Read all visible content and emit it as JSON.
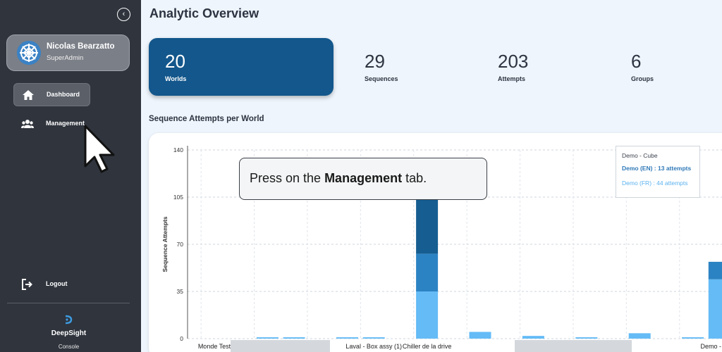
{
  "sidebar": {
    "collapse_icon": "chevron-left-icon",
    "user": {
      "name": "Nicolas Bearzatto",
      "role": "SuperAdmin",
      "avatar_icon": "snowflake-avatar-icon"
    },
    "items": [
      {
        "label": "Dashboard",
        "icon": "home-icon",
        "active": true
      },
      {
        "label": "Management",
        "icon": "users-icon",
        "active": false
      }
    ],
    "logout_label": "Logout",
    "brand": {
      "name": "DeepSight",
      "sub": "Console"
    }
  },
  "header": {
    "title": "Analytic Overview"
  },
  "stats": [
    {
      "value": "20",
      "label": "Worlds",
      "highlight": true
    },
    {
      "value": "29",
      "label": "Sequences"
    },
    {
      "value": "203",
      "label": "Attempts"
    },
    {
      "value": "6",
      "label": "Groups"
    }
  ],
  "section_title": "Sequence Attempts per World",
  "chart_data": {
    "type": "bar",
    "stacked": true,
    "ylabel": "Sequence Attempts",
    "ylim": [
      0,
      140
    ],
    "yticks": [
      "0",
      "35",
      "70",
      "105",
      "140"
    ],
    "categories": [
      "Monde Test",
      "",
      "",
      "",
      "",
      "",
      "Laval - Box assy (1)",
      "",
      "Chiller de la drive",
      "",
      "",
      "",
      "",
      "",
      "",
      "",
      "",
      "",
      "",
      "Demo - Cube"
    ],
    "series": [
      {
        "name": "",
        "color": "#64bbf6",
        "values": [
          0,
          0,
          1,
          1,
          0,
          1,
          1,
          0,
          35,
          0,
          5,
          0,
          2,
          0,
          1,
          0,
          4,
          0,
          1,
          44
        ]
      },
      {
        "name": "",
        "color": "#2c83c3",
        "values": [
          0,
          0,
          0,
          0,
          0,
          0,
          0,
          0,
          28,
          0,
          0,
          0,
          0,
          0,
          0,
          0,
          0,
          0,
          0,
          13
        ]
      },
      {
        "name": "",
        "color": "#165e91",
        "values": [
          0,
          0,
          0,
          0,
          0,
          0,
          0,
          0,
          40,
          0,
          0,
          0,
          0,
          0,
          0,
          0,
          0,
          0,
          0,
          0
        ]
      }
    ],
    "legend": {
      "title": "Demo - Cube",
      "entries": [
        "Demo (EN) : 13 attempts",
        "Demo (FR) : 44 attempts"
      ]
    }
  },
  "tooltip": {
    "prefix": "Press on the ",
    "bold": "Management",
    "suffix": " tab."
  },
  "colors": {
    "sidebar": "#2f343d",
    "accent": "#13578c",
    "background": "#eef5fc"
  }
}
